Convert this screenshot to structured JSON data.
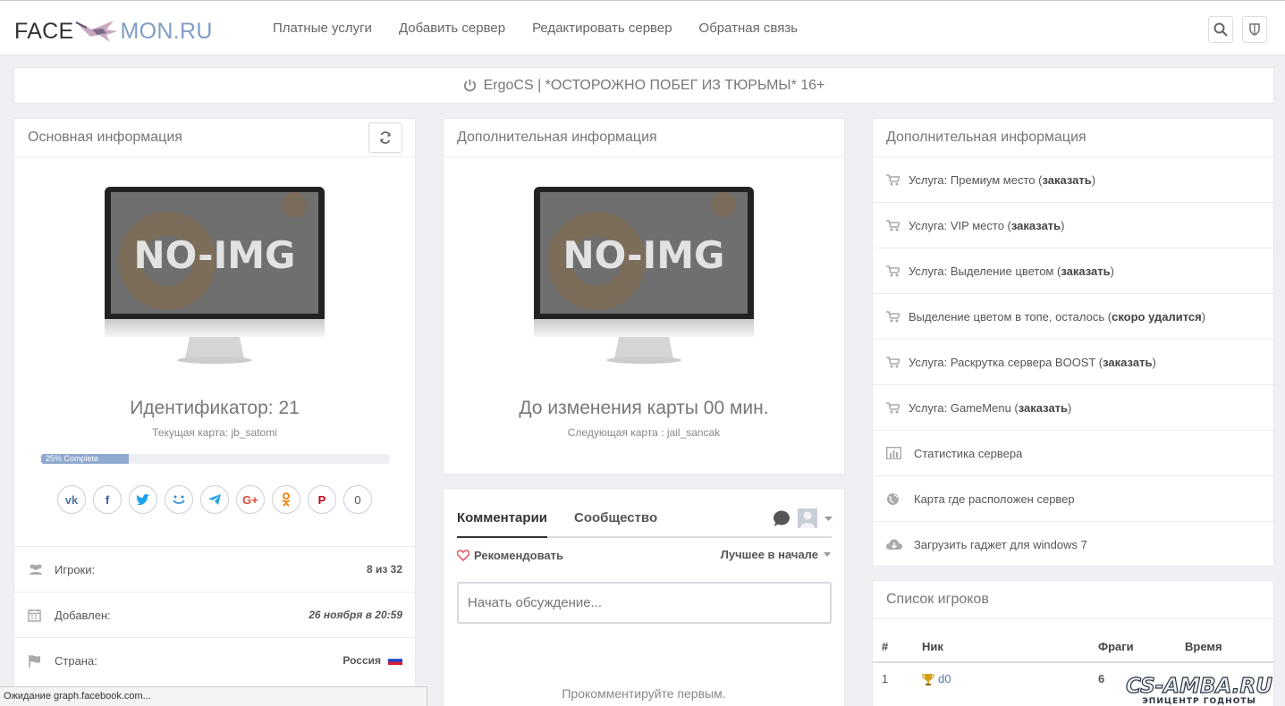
{
  "header": {
    "logo_left": "FACE",
    "logo_right": "MON.RU",
    "nav": [
      "Платные услуги",
      "Добавить сервер",
      "Редактировать сервер",
      "Обратная связь"
    ]
  },
  "banner": {
    "server_name": "ErgoCS | *ОСТОРОЖНО ПОБЕГ ИЗ ТЮРЬМЫ* 16+"
  },
  "main_info": {
    "title": "Основная информация",
    "image_text": "NO-IMG",
    "identifier": "Идентификатор: 21",
    "current_map": "Текущая карта: jb_satomi",
    "progress_label": "25% Complete",
    "progress_value": 25,
    "share_count": "0",
    "rows": [
      {
        "label": "Игроки:",
        "value": "8 из 32"
      },
      {
        "label": "Добавлен:",
        "value": "26 ноября в 20:59"
      },
      {
        "label": "Страна:",
        "value": "Россия"
      }
    ]
  },
  "extra_info": {
    "title": "Дополнительная информация",
    "image_text": "NO-IMG",
    "map_change": "До изменения карты 00 мин.",
    "next_map": "Следующая карта : jail_sancak"
  },
  "comments": {
    "tab_comments": "Комментарии",
    "tab_community": "Сообщество",
    "recommend": "Рекомендовать",
    "sort": "Лучшее в начале",
    "placeholder": "Начать обсуждение...",
    "empty": "Прокомментируйте первым."
  },
  "services": {
    "title": "Дополнительная информация",
    "items": [
      {
        "text": "Услуга: Премиум место (",
        "bold": "заказать",
        "tail": ")"
      },
      {
        "text": "Услуга: VIP место (",
        "bold": "заказать",
        "tail": ")"
      },
      {
        "text": "Услуга: Выделение цветом (",
        "bold": "заказать",
        "tail": ")"
      },
      {
        "text": "Выделение цветом в топе, осталось  (",
        "bold": "скоро удалится",
        "tail": ")"
      },
      {
        "text": "Услуга: Раскрутка сервера BOOST (",
        "bold": "заказать",
        "tail": ")"
      },
      {
        "text": "Услуга: GameMenu (",
        "bold": "заказать",
        "tail": ")"
      }
    ],
    "links": [
      "Статистика сервера",
      "Карта где расположен сервер",
      "Загрузить гаджет для windows 7"
    ]
  },
  "players": {
    "title": "Список игроков",
    "columns": [
      "#",
      "Ник",
      "Фраги",
      "Время"
    ],
    "rows": [
      {
        "num": "1",
        "nick": "d0",
        "frags": "6"
      }
    ]
  },
  "status_bar": "Ожидание graph.facebook.com...",
  "watermark": {
    "line1": "CS-AMBA.RU",
    "line2": "ЭПИЦЕНТР ГОДНОТЫ"
  }
}
